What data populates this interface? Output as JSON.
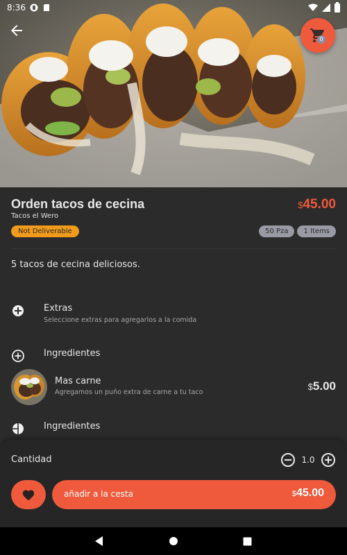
{
  "status_bar": {
    "time": "8:36"
  },
  "header": {
    "cart_count": "0"
  },
  "product": {
    "title": "Orden tacos de cecina",
    "price_currency": "$",
    "price_value": "45.00",
    "restaurant": "Tacos el Wero",
    "delivery_badge": "Not Deliverable",
    "chips": [
      "50 Pza",
      "1 Items"
    ],
    "description": "5 tacos de cecina deliciosos."
  },
  "extras": {
    "title": "Extras",
    "description": "Seleccione extras para agregarlos a la comida"
  },
  "ingredients_1": {
    "title": "Ingredientes"
  },
  "ingredient_item": {
    "name": "Mas carne",
    "description": "Agregamos un puño extra de carne a tu taco",
    "price_currency": "$",
    "price_value": "5.00"
  },
  "ingredients_2": {
    "title": "Ingredientes"
  },
  "bottom_panel": {
    "quantity_label": "Cantidad",
    "quantity_value": "1.0",
    "add_to_cart_label": "añadir a la cesta",
    "total_currency": "$",
    "total_value": "45.00"
  },
  "colors": {
    "accent": "#ef5a3c",
    "badge_orange": "#f29b1b",
    "chip_grey": "#9a9aa5",
    "background": "#2b2b2b"
  },
  "icons": {
    "back": "arrow-back-icon",
    "cart": "shopping-cart-icon",
    "add": "plus-circle-icon",
    "favorite": "heart-icon",
    "decrease": "minus-circle-icon",
    "increase": "plus-circle-icon"
  }
}
